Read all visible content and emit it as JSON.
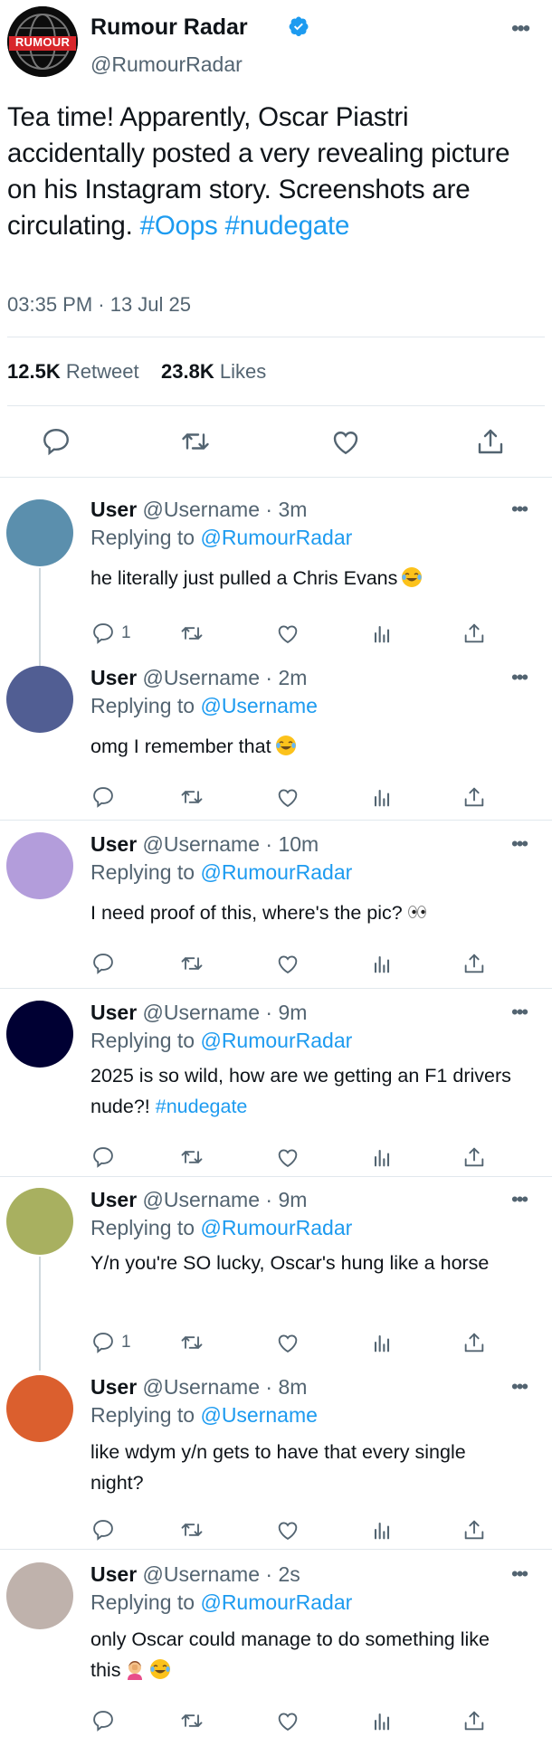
{
  "tweet": {
    "name": "Rumour Radar",
    "handle": "@RumourRadar",
    "avatar_text": "RUMOUR",
    "text_plain": "Tea time! Apparently, Oscar Piastri accidentally posted a very revealing picture on his Instagram story. Screenshots are circulating.",
    "hashtags": [
      "#Oops",
      "#nudegate"
    ],
    "timestamp": "03:35 PM · 13 Jul 25",
    "retweets_count": "12.5K",
    "retweets_label": "Retweet",
    "likes_count": "23.8K",
    "likes_label": "Likes"
  },
  "replies": [
    {
      "name": "User",
      "handle": "@Username",
      "time": "3m",
      "replying_label": "Replying to",
      "replying_to": "@RumourRadar",
      "text": "he literally just pulled a Chris Evans",
      "emoji": [
        "face-with-tears-of-joy"
      ],
      "reply_count": "1",
      "avatar_color": "#5b8fad"
    },
    {
      "name": "User",
      "handle": "@Username",
      "time": "2m",
      "replying_label": "Replying to",
      "replying_to": "@Username",
      "text": "omg I remember that",
      "emoji": [
        "face-with-tears-of-joy"
      ],
      "reply_count": "",
      "avatar_color": "#515e93"
    },
    {
      "name": "User",
      "handle": "@Username",
      "time": "10m",
      "replying_label": "Replying to",
      "replying_to": "@RumourRadar",
      "text": "I need proof of this, where's the pic?",
      "emoji": [
        "eyes"
      ],
      "reply_count": "",
      "avatar_color": "#b39ddb"
    },
    {
      "name": "User",
      "handle": "@Username",
      "time": "9m",
      "replying_label": "Replying to",
      "replying_to": "@RumourRadar",
      "text": "2025 is so wild, how are we getting an F1 drivers nude?!",
      "hashtag": "#nudegate",
      "emoji": [],
      "reply_count": "",
      "avatar_color": "#000033"
    },
    {
      "name": "User",
      "handle": "@Username",
      "time": "9m",
      "replying_label": "Replying to",
      "replying_to": "@RumourRadar",
      "text": "Y/n you're SO lucky, Oscar's hung like a horse",
      "emoji": [],
      "reply_count": "1",
      "avatar_color": "#a8b060"
    },
    {
      "name": "User",
      "handle": "@Username",
      "time": "8m",
      "replying_label": "Replying to",
      "replying_to": "@Username",
      "text": "like wdym y/n gets to have that every single night?",
      "emoji": [],
      "reply_count": "",
      "avatar_color": "#db5f2e"
    },
    {
      "name": "User",
      "handle": "@Username",
      "time": "2s",
      "replying_label": "Replying to",
      "replying_to": "@RumourRadar",
      "text": "only Oscar could manage to do something like this",
      "emoji": [
        "person-facepalming",
        "face-with-tears-of-joy"
      ],
      "reply_count": "",
      "avatar_color": "#bfb2ac"
    }
  ],
  "colors": {
    "link": "#1d9bf0",
    "muted": "#536471",
    "text": "#0f1419",
    "divider": "#e1e8ed"
  },
  "icons": {
    "reply": "speech-bubble-icon",
    "retweet": "retweet-icon",
    "like": "heart-icon",
    "analytics": "bar-chart-icon",
    "share": "share-upload-icon",
    "more": "more-dots-icon",
    "verified": "verified-badge-icon"
  }
}
